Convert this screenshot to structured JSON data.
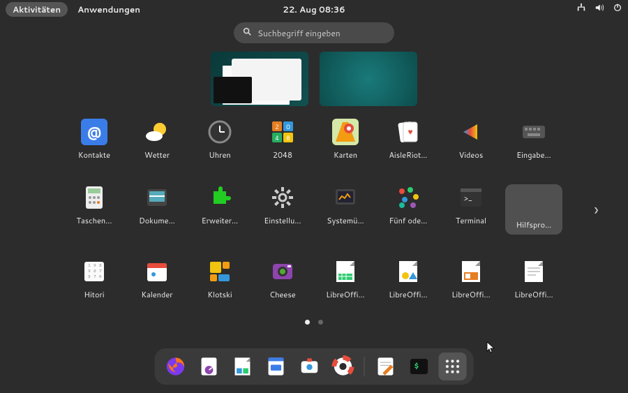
{
  "topbar": {
    "activities": "Aktivitäten",
    "applications": "Anwendungen",
    "datetime": "22. Aug  08:36"
  },
  "search": {
    "placeholder": "Suchbegriff eingeben"
  },
  "apps": [
    {
      "name": "Kontakte",
      "icon": "contacts"
    },
    {
      "name": "Wetter",
      "icon": "weather"
    },
    {
      "name": "Uhren",
      "icon": "clocks"
    },
    {
      "name": "2048",
      "icon": "2048"
    },
    {
      "name": "Karten",
      "icon": "maps"
    },
    {
      "name": "AisleRiot…",
      "icon": "cards"
    },
    {
      "name": "Videos",
      "icon": "videos"
    },
    {
      "name": "Eingabe…",
      "icon": "keyboard"
    },
    {
      "name": "Taschen…",
      "icon": "calculator"
    },
    {
      "name": "Dokume…",
      "icon": "scanner"
    },
    {
      "name": "Erweiter…",
      "icon": "extensions"
    },
    {
      "name": "Einstellu…",
      "icon": "settings"
    },
    {
      "name": "Systemü…",
      "icon": "monitor"
    },
    {
      "name": "Fünf ode…",
      "icon": "dots"
    },
    {
      "name": "Terminal",
      "icon": "terminal"
    },
    {
      "name": "Hilfspro…",
      "icon": "folder"
    },
    {
      "name": "Hitori",
      "icon": "hitori"
    },
    {
      "name": "Kalender",
      "icon": "calendar"
    },
    {
      "name": "Klotski",
      "icon": "klotski"
    },
    {
      "name": "Cheese",
      "icon": "cheese"
    },
    {
      "name": "LibreOffi…",
      "icon": "lo-calc"
    },
    {
      "name": "LibreOffi…",
      "icon": "lo-draw"
    },
    {
      "name": "LibreOffi…",
      "icon": "lo-impress"
    },
    {
      "name": "LibreOffi…",
      "icon": "lo-writer"
    }
  ],
  "page": {
    "current": 1,
    "total": 2
  },
  "dock": [
    {
      "name": "firefox"
    },
    {
      "name": "system-monitor"
    },
    {
      "name": "libreoffice"
    },
    {
      "name": "files"
    },
    {
      "name": "software"
    },
    {
      "name": "help"
    },
    {
      "sep": true
    },
    {
      "name": "text-editor"
    },
    {
      "name": "terminal-green"
    },
    {
      "name": "show-apps",
      "active": true
    }
  ]
}
